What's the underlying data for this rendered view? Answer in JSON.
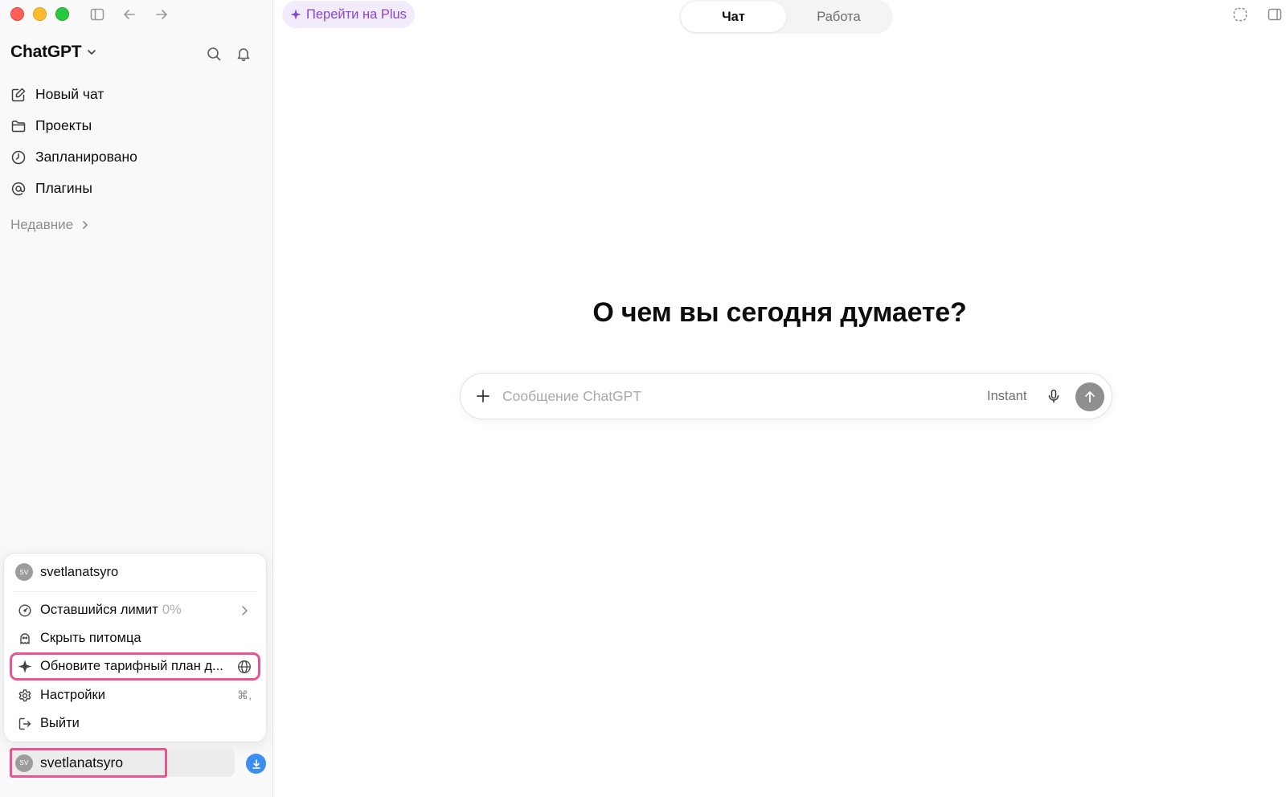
{
  "app": {
    "brand": "ChatGPT"
  },
  "sidebar": {
    "nav": [
      {
        "label": "Новый чат",
        "icon": "edit-icon"
      },
      {
        "label": "Проекты",
        "icon": "folder-icon"
      },
      {
        "label": "Запланировано",
        "icon": "clock-icon"
      },
      {
        "label": "Плагины",
        "icon": "at-sign-icon"
      }
    ],
    "recent_label": "Недавние"
  },
  "account_menu": {
    "avatar_initials": "SV",
    "username": "svetlanatsyro",
    "items": [
      {
        "label": "Оставшийся лимит",
        "value": "0%",
        "icon": "gauge-icon",
        "trailing": "chevron-right-icon"
      },
      {
        "label": "Скрыть питомца",
        "icon": "pet-icon"
      },
      {
        "label": "Обновите тарифный план д...",
        "icon": "sparkle-icon",
        "trailing": "globe-icon",
        "highlighted": true
      },
      {
        "label": "Настройки",
        "icon": "gear-icon",
        "shortcut": "⌘,"
      },
      {
        "label": "Выйти",
        "icon": "logout-icon"
      }
    ]
  },
  "footer": {
    "avatar_initials": "SV",
    "username": "svetlanatsyro"
  },
  "header": {
    "upgrade_label": "Перейти на Plus",
    "tabs": [
      {
        "label": "Чат",
        "active": true
      },
      {
        "label": "Работа",
        "active": false
      }
    ]
  },
  "main": {
    "headline": "О чем вы сегодня думаете?",
    "composer": {
      "placeholder": "Сообщение ChatGPT",
      "value": "",
      "mode": "Instant"
    }
  },
  "colors": {
    "accent_purple": "#8846d6",
    "highlight_pink": "#e9568f",
    "download_blue": "#3b8df0"
  }
}
